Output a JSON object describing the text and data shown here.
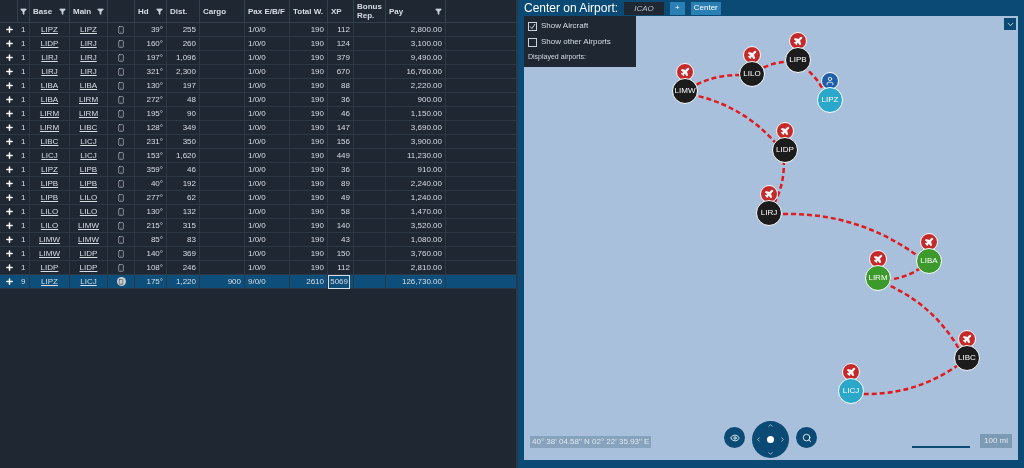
{
  "table": {
    "columns": [
      {
        "filter": true
      },
      {
        "label": "Base",
        "filter": true
      },
      {
        "label": "Main",
        "filter": true
      },
      {
        "filter": false
      },
      {
        "label": "Hd",
        "filter": true
      },
      {
        "label": "Dist.",
        "filter": false
      },
      {
        "label": "Cargo",
        "filter": false
      },
      {
        "label": "Pax E/B/F",
        "filter": false
      },
      {
        "label": "Total W.",
        "filter": false
      },
      {
        "label": "XP",
        "filter": false
      },
      {
        "label": "Bonus Rep.",
        "filter": false
      },
      {
        "label": "Pay",
        "filter": true
      }
    ],
    "rows": [
      {
        "count": "1",
        "base": "LIPZ",
        "main": "LIPZ",
        "hd": "39°",
        "dist": "255",
        "pax": "1/0/0",
        "total_w": "190",
        "xp": "112",
        "pay": "2,800.00",
        "selected": false
      },
      {
        "count": "1",
        "base": "LIDP",
        "main": "LIRJ",
        "hd": "160°",
        "dist": "260",
        "pax": "1/0/0",
        "total_w": "190",
        "xp": "124",
        "pay": "3,100.00",
        "selected": false
      },
      {
        "count": "1",
        "base": "LIRJ",
        "main": "LIRJ",
        "hd": "197°",
        "dist": "1,096",
        "pax": "1/0/0",
        "total_w": "190",
        "xp": "379",
        "pay": "9,490.00",
        "selected": false
      },
      {
        "count": "1",
        "base": "LIRJ",
        "main": "LIRJ",
        "hd": "321°",
        "dist": "2,300",
        "pax": "1/0/0",
        "total_w": "190",
        "xp": "670",
        "pay": "16,760.00",
        "selected": false
      },
      {
        "count": "1",
        "base": "LIBA",
        "main": "LIBA",
        "hd": "130°",
        "dist": "197",
        "pax": "1/0/0",
        "total_w": "190",
        "xp": "88",
        "pay": "2,220.00",
        "selected": false
      },
      {
        "count": "1",
        "base": "LIBA",
        "main": "LIRM",
        "hd": "272°",
        "dist": "48",
        "pax": "1/0/0",
        "total_w": "190",
        "xp": "36",
        "pay": "900.00",
        "selected": false
      },
      {
        "count": "1",
        "base": "LIRM",
        "main": "LIRM",
        "hd": "195°",
        "dist": "90",
        "pax": "1/0/0",
        "total_w": "190",
        "xp": "46",
        "pay": "1,150.00",
        "selected": false
      },
      {
        "count": "1",
        "base": "LIRM",
        "main": "LIBC",
        "hd": "128°",
        "dist": "349",
        "pax": "1/0/0",
        "total_w": "190",
        "xp": "147",
        "pay": "3,690.00",
        "selected": false
      },
      {
        "count": "1",
        "base": "LIBC",
        "main": "LICJ",
        "hd": "231°",
        "dist": "350",
        "pax": "1/0/0",
        "total_w": "190",
        "xp": "156",
        "pay": "3,900.00",
        "selected": false
      },
      {
        "count": "1",
        "base": "LICJ",
        "main": "LICJ",
        "hd": "153°",
        "dist": "1,620",
        "pax": "1/0/0",
        "total_w": "190",
        "xp": "449",
        "pay": "11,230.00",
        "selected": false
      },
      {
        "count": "1",
        "base": "LIPZ",
        "main": "LIPB",
        "hd": "359°",
        "dist": "46",
        "pax": "1/0/0",
        "total_w": "190",
        "xp": "36",
        "pay": "910.00",
        "selected": false
      },
      {
        "count": "1",
        "base": "LIPB",
        "main": "LIPB",
        "hd": "40°",
        "dist": "192",
        "pax": "1/0/0",
        "total_w": "190",
        "xp": "89",
        "pay": "2,240.00",
        "selected": false
      },
      {
        "count": "1",
        "base": "LIPB",
        "main": "LILO",
        "hd": "277°",
        "dist": "62",
        "pax": "1/0/0",
        "total_w": "190",
        "xp": "49",
        "pay": "1,240.00",
        "selected": false
      },
      {
        "count": "1",
        "base": "LILO",
        "main": "LILO",
        "hd": "130°",
        "dist": "132",
        "pax": "1/0/0",
        "total_w": "190",
        "xp": "58",
        "pay": "1,470.00",
        "selected": false
      },
      {
        "count": "1",
        "base": "LILO",
        "main": "LIMW",
        "hd": "215°",
        "dist": "315",
        "pax": "1/0/0",
        "total_w": "190",
        "xp": "140",
        "pay": "3,520.00",
        "selected": false
      },
      {
        "count": "1",
        "base": "LIMW",
        "main": "LIMW",
        "hd": "85°",
        "dist": "83",
        "pax": "1/0/0",
        "total_w": "190",
        "xp": "43",
        "pay": "1,080.00",
        "selected": false
      },
      {
        "count": "1",
        "base": "LIMW",
        "main": "LIDP",
        "hd": "140°",
        "dist": "369",
        "pax": "1/0/0",
        "total_w": "190",
        "xp": "150",
        "pay": "3,760.00",
        "selected": false
      },
      {
        "count": "1",
        "base": "LIDP",
        "main": "LIDP",
        "hd": "108°",
        "dist": "246",
        "pax": "1/0/0",
        "total_w": "190",
        "xp": "112",
        "pay": "2,810.00",
        "selected": false
      },
      {
        "count": "9",
        "base": "LIPZ",
        "main": "LICJ",
        "hd": "175°",
        "dist": "1,220",
        "cargo": "900",
        "pax": "9/0/0",
        "total_w": "2610",
        "xp": "5069",
        "pay": "126,730.00",
        "selected": true
      }
    ]
  },
  "map_panel": {
    "title": "Center on Airport:",
    "icao_placeholder": "ICAO",
    "add_button": "+",
    "center_button": "Center",
    "options": [
      {
        "label": "Show Aircraft",
        "checked": true
      },
      {
        "label": "Show other Airports",
        "checked": false
      }
    ],
    "displayed_label": "Displayed airports:",
    "airports": [
      {
        "code": "LIMW",
        "color": "#1c1c1c",
        "kind": "aircraft"
      },
      {
        "code": "LILO",
        "color": "#1c1c1c",
        "kind": "aircraft"
      },
      {
        "code": "LIPB",
        "color": "#1c1c1c",
        "kind": "aircraft"
      },
      {
        "code": "LIPZ",
        "color": "#2aa7c9",
        "kind": "person"
      },
      {
        "code": "LIDP",
        "color": "#1c1c1c",
        "kind": "aircraft"
      },
      {
        "code": "LIRJ",
        "color": "#1c1c1c",
        "kind": "aircraft"
      },
      {
        "code": "LIBA",
        "color": "#3b9a2b",
        "kind": "aircraft"
      },
      {
        "code": "LIRM",
        "color": "#3b9a2b",
        "kind": "aircraft"
      },
      {
        "code": "LIBC",
        "color": "#1c1c1c",
        "kind": "aircraft"
      },
      {
        "code": "LICJ",
        "color": "#2aa7c9",
        "kind": "aircraft"
      }
    ],
    "coordinates": "40° 38' 04.58\" N 02° 22' 35.93\" E",
    "scale": "100 mi"
  }
}
